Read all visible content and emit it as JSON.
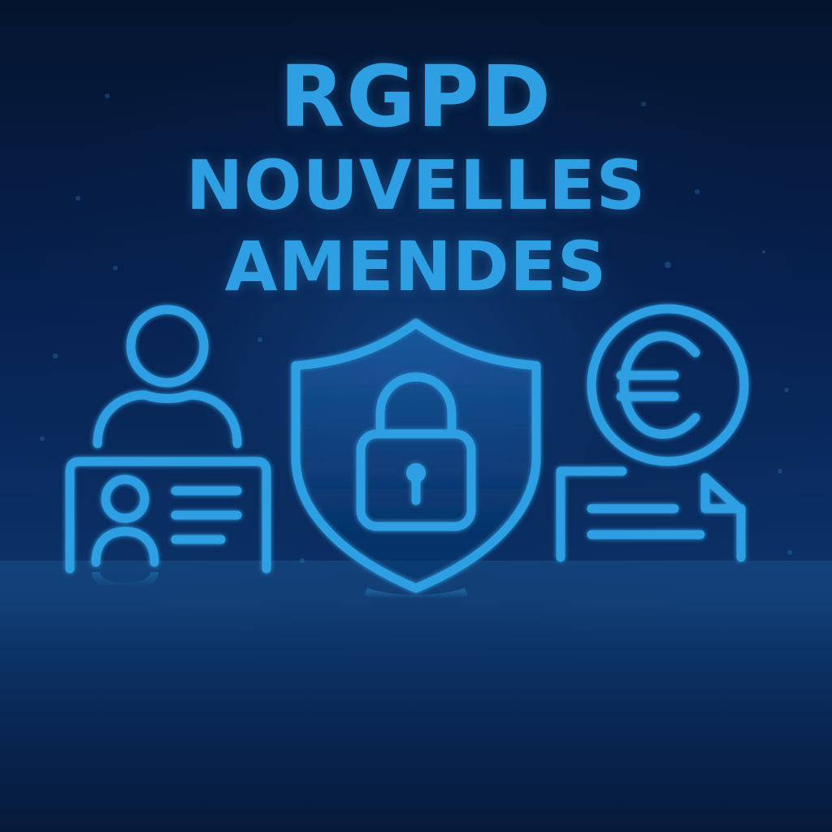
{
  "headline": {
    "line1": "RGPD",
    "line2": "NOUVELLES",
    "line3": "AMENDES"
  },
  "icons": {
    "person": "person-icon",
    "id_card": "id-card-icon",
    "shield": "shield-icon",
    "padlock": "padlock-icon",
    "euro_coin": "euro-coin-icon",
    "document": "document-icon"
  },
  "colors": {
    "accent": "#2f9fe3",
    "background_top": "#04142e",
    "background_mid": "#0a2e63"
  }
}
